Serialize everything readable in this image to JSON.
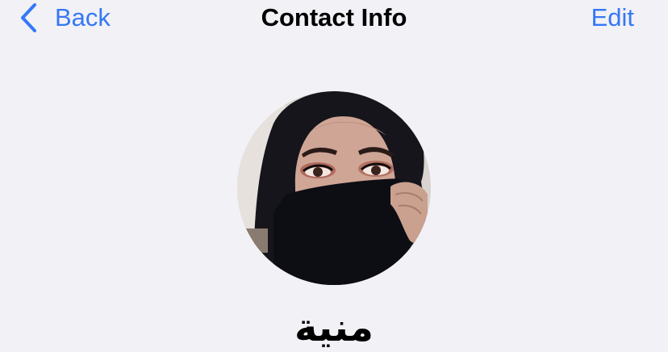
{
  "nav": {
    "back_label": "Back",
    "title": "Contact Info",
    "edit_label": "Edit"
  },
  "contact": {
    "name": "منية"
  },
  "colors": {
    "accent": "#3478f6",
    "background": "#f2f1f6",
    "text": "#000000"
  },
  "icons": {
    "back": "chevron-left-icon"
  }
}
